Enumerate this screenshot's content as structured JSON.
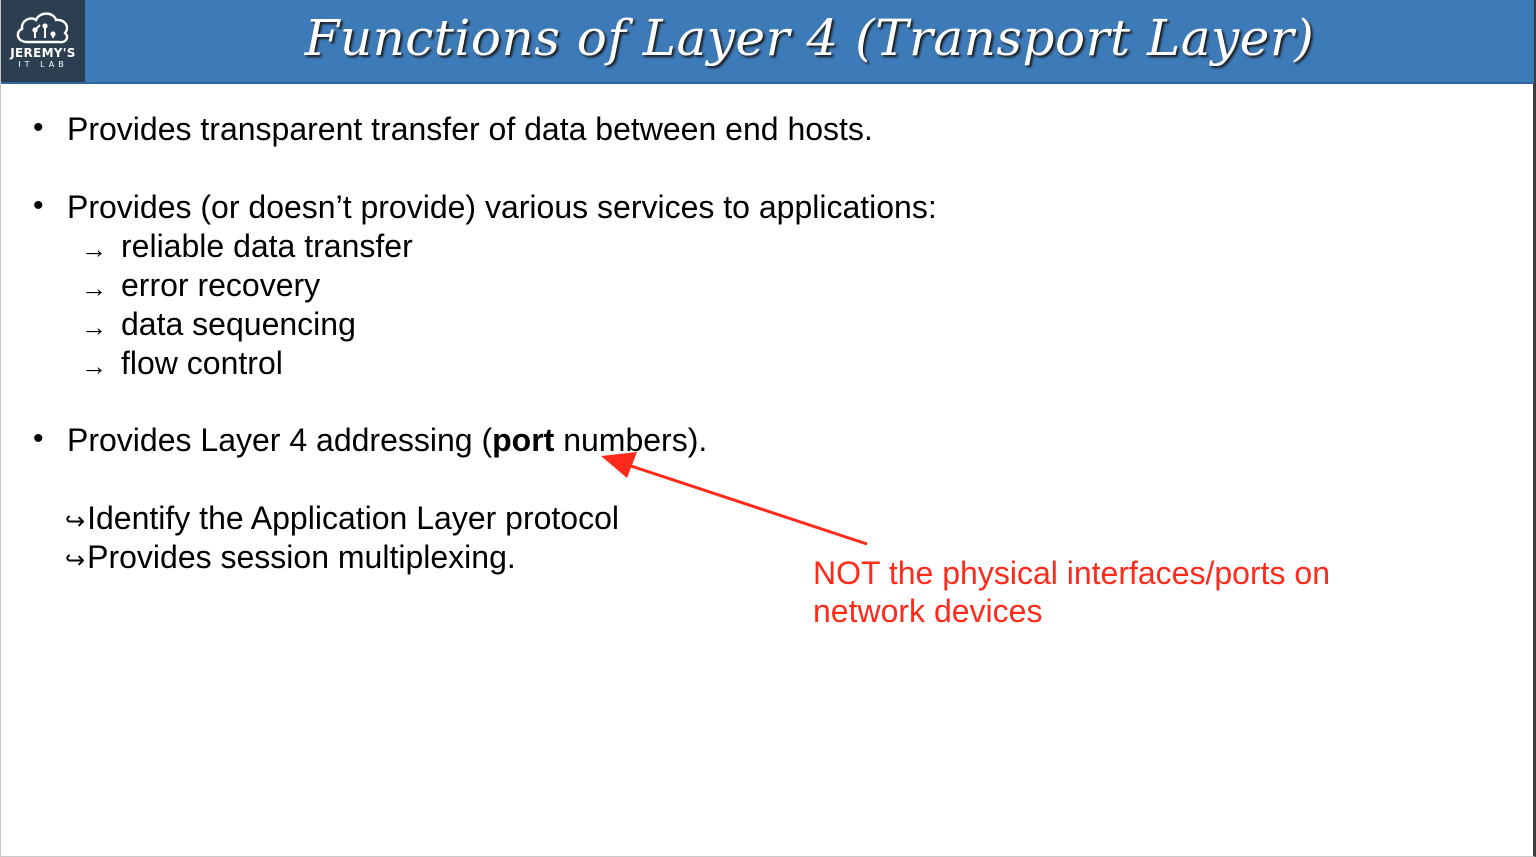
{
  "header": {
    "title": "Functions of Layer 4 (Transport Layer)",
    "logo_line1": "JEREMY'S",
    "logo_line2": "IT LAB",
    "background": "#3d7ab8"
  },
  "bullets": [
    {
      "marker": "•",
      "text": "Provides transparent transfer of data between end hosts."
    },
    {
      "marker": "•",
      "text": "Provides (or doesn’t provide) various services to applications:",
      "subitems": [
        {
          "marker": "→",
          "text": "reliable data transfer"
        },
        {
          "marker": "→",
          "text": "error recovery"
        },
        {
          "marker": "→",
          "text": "data sequencing"
        },
        {
          "marker": "→",
          "text": "flow control"
        }
      ]
    },
    {
      "marker": "•",
      "text_before": "Provides Layer 4 addressing (",
      "text_bold": "port",
      "text_after": " numbers).",
      "subitems": [
        {
          "marker": "↪",
          "text": "Identify the Application Layer protocol"
        },
        {
          "marker": "↪",
          "text": "Provides session multiplexing."
        }
      ]
    }
  ],
  "annotation": {
    "line1": "NOT the physical interfaces/ports on",
    "line2": "network devices",
    "color": "#ff2a1a"
  }
}
